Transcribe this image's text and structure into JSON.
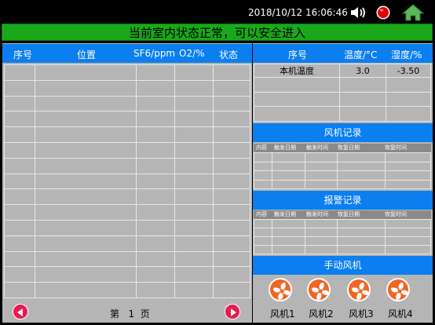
{
  "header": {
    "datetime": "2018/10/12 16:06:46",
    "icons": [
      "speaker-icon",
      "alarm-light-icon",
      "home-icon"
    ],
    "banner": "当前室内状态正常，可以安全进入",
    "banner_color": "#1aa81a"
  },
  "sensor_table": {
    "columns": [
      "序号",
      "位置",
      "SF6/ppm",
      "O2/%",
      "状态"
    ],
    "rows": []
  },
  "pager": {
    "prefix": "第",
    "page": "1",
    "suffix": "页"
  },
  "local_table": {
    "columns": [
      "序号",
      "温度/°C",
      "湿度/%"
    ],
    "rows": [
      {
        "name": "本机温度",
        "temp": "3.0",
        "humidity": "-3.50"
      }
    ]
  },
  "fan_log": {
    "title": "风机记录",
    "columns": [
      "内容",
      "触发日期",
      "触发时间",
      "恢复日期",
      "恢复时间"
    ]
  },
  "alarm_log": {
    "title": "报警记录",
    "columns": [
      "内容",
      "触发日期",
      "触发时间",
      "恢复日期",
      "恢复时间"
    ]
  },
  "manual_fans": {
    "title": "手动风机",
    "fans": [
      "风机1",
      "风机2",
      "风机3",
      "风机4"
    ]
  },
  "colors": {
    "header_blue": "#0b7ef0",
    "panel_gray": "#b5b5b5",
    "fan_orange": "#f26522",
    "nav_red": "#e8194d"
  }
}
